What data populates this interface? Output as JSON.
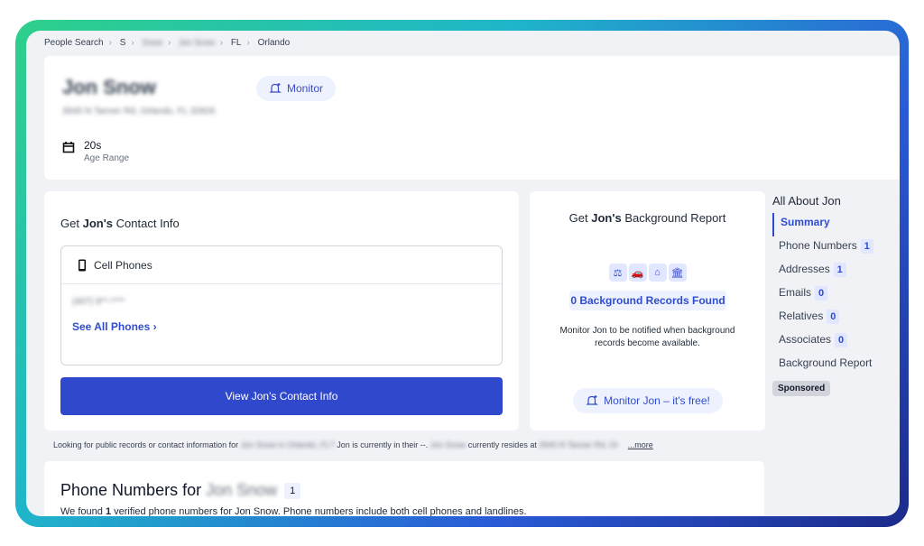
{
  "breadcrumb": {
    "items": [
      "People Search",
      "S",
      "Snow",
      "Jon Snow",
      "FL",
      "Orlando"
    ]
  },
  "profile": {
    "name": "Jon Snow",
    "address": "3940 N Tanner Rd, Orlando, FL 32826",
    "monitor_label": "Monitor",
    "age_value": "20s",
    "age_label": "Age Range"
  },
  "contact": {
    "title_prefix": "Get",
    "title_name": "Jon's",
    "title_suffix": "Contact Info",
    "cell_phones_label": "Cell Phones",
    "phone_masked": "(407) 9**-****",
    "see_all_label": "See All Phones",
    "view_button_label": "View Jon's Contact Info"
  },
  "background": {
    "title_prefix": "Get",
    "title_name": "Jon's",
    "title_suffix": "Background Report",
    "records_found": "0 Background Records Found",
    "note": "Monitor Jon to be notified when background records become available.",
    "monitor_button_label": "Monitor Jon – it's free!"
  },
  "sidebar": {
    "title": "All About Jon",
    "items": [
      {
        "label": "Summary",
        "count": null
      },
      {
        "label": "Phone Numbers",
        "count": "1"
      },
      {
        "label": "Addresses",
        "count": "1"
      },
      {
        "label": "Emails",
        "count": "0"
      },
      {
        "label": "Relatives",
        "count": "0"
      },
      {
        "label": "Associates",
        "count": "0"
      },
      {
        "label": "Background Report",
        "count": null
      }
    ],
    "sponsored_label": "Sponsored"
  },
  "lookup": {
    "text_a": "Looking for public records or contact information for",
    "blur_a": "Jon Snow in Orlando, FL?",
    "text_b": "Jon is currently in their --.",
    "blur_b": "Jon Snow",
    "text_c": "currently resides at",
    "blur_c": "3940 N Tanner Rd, Or",
    "more_label": "...more"
  },
  "phones_section": {
    "title": "Phone Numbers for",
    "title_name": "Jon Snow",
    "count": "1",
    "desc_prefix": "We found",
    "desc_count": "1",
    "desc_suffix": "verified phone numbers for Jon Snow. Phone numbers include both cell phones and landlines."
  }
}
